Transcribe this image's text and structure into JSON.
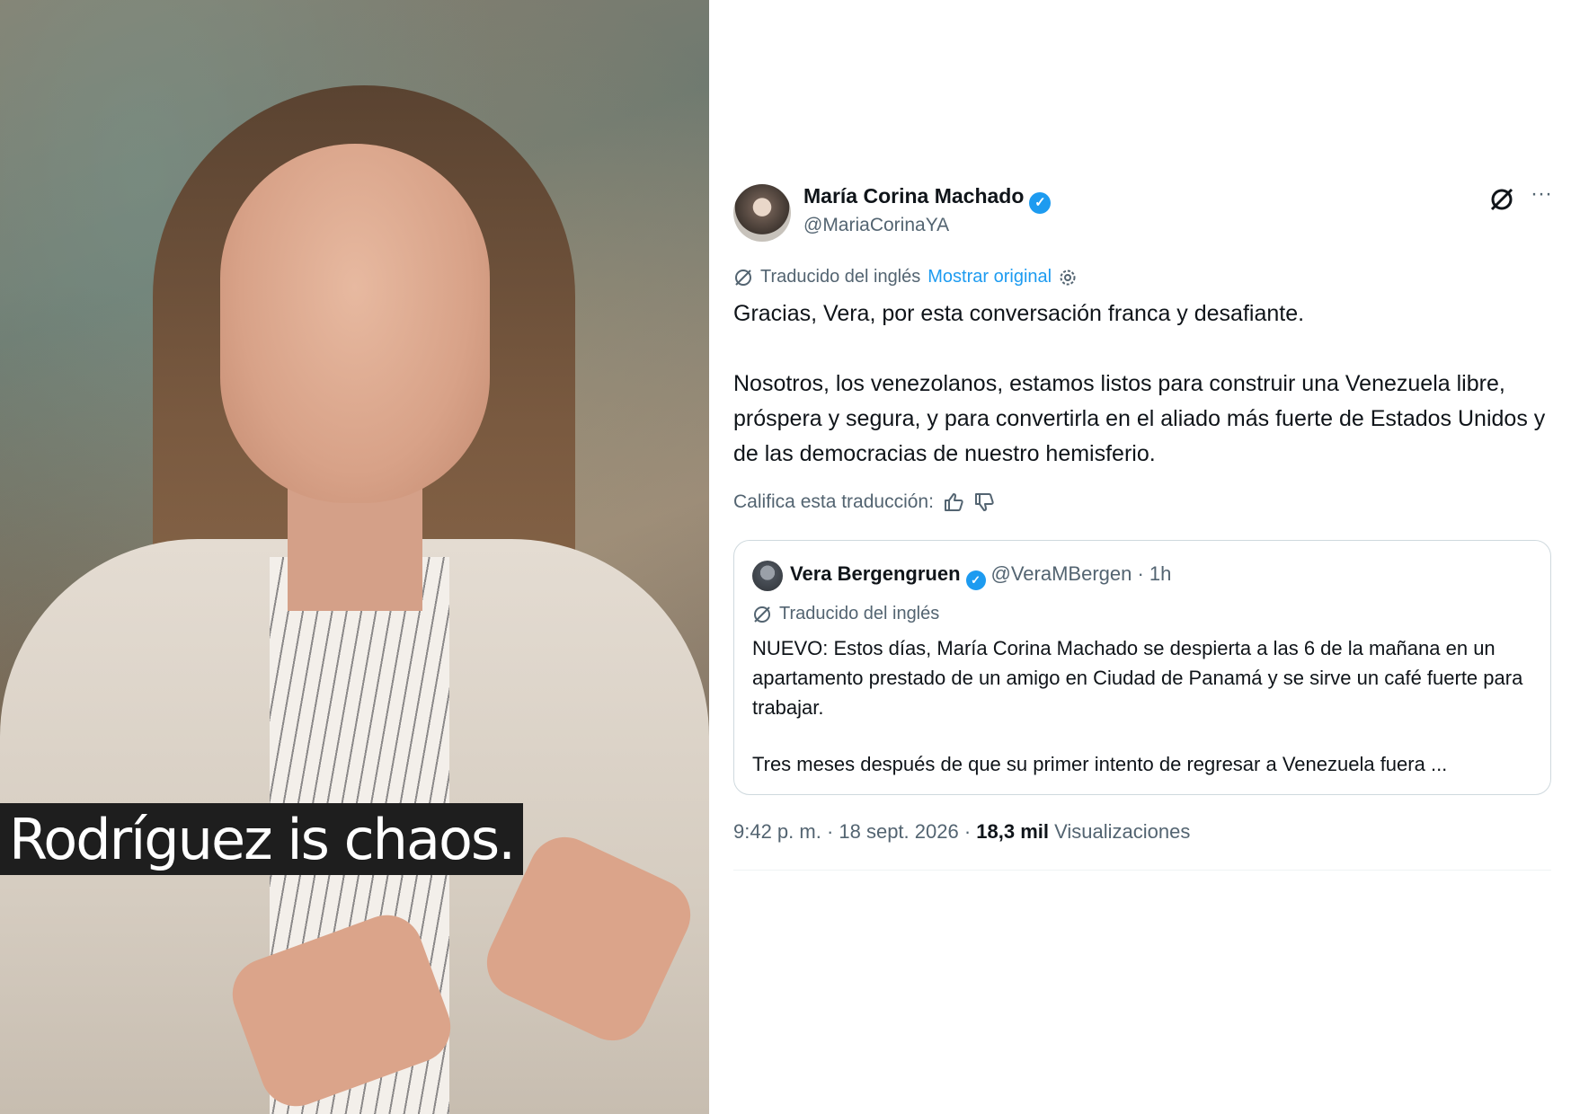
{
  "video": {
    "subtitle": "Rodríguez is chaos."
  },
  "tweet": {
    "author_name": "María Corina Machado",
    "author_handle": "@MariaCorinaYA",
    "translated_label": "Traducido del inglés",
    "show_original_label": "Mostrar original",
    "paragraphs": [
      "Gracias, Vera, por esta conversación franca y desafiante.",
      "Nosotros, los venezolanos, estamos listos para construir una Venezuela libre, próspera y segura, y para convertirla en el aliado más fuerte de Estados Unidos y de las democracias de nuestro hemisferio."
    ],
    "rate_label": "Califica esta traducción:",
    "timestamp": "9:42 p. m. · 18 sept. 2026 · ",
    "views_count": "18,3 mil",
    "views_label": " Visualizaciones",
    "accent_color": "#1d9bf0"
  },
  "quote": {
    "author_name": "Vera Bergengruen",
    "author_handle_time": "@VeraMBergen · 1h",
    "translated_label": "Traducido del inglés",
    "paragraphs": [
      "NUEVO: Estos días, María Corina Machado se despierta a las 6 de la mañana en un apartamento prestado de un amigo en Ciudad de Panamá y se sirve un café fuerte para trabajar.",
      "Tres meses después de que su primer intento de regresar a Venezuela fuera ..."
    ]
  },
  "icons": {
    "verified": "verified-badge-icon",
    "grok": "grok-icon",
    "more": "more-icon",
    "translate": "translate-icon",
    "settings": "settings-gear-icon",
    "thumbs_up": "thumbs-up-icon",
    "thumbs_down": "thumbs-down-icon"
  }
}
